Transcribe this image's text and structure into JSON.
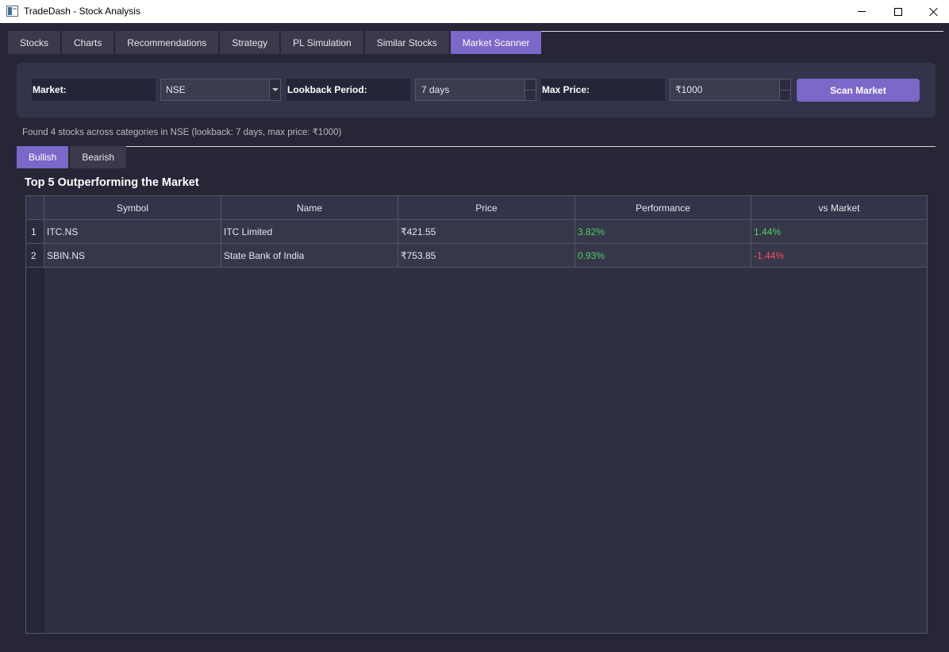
{
  "window": {
    "title": "TradeDash - Stock Analysis",
    "icon": "app-window-icon"
  },
  "main_tabs": [
    {
      "label": "Stocks",
      "active": false
    },
    {
      "label": "Charts",
      "active": false
    },
    {
      "label": "Recommendations",
      "active": false
    },
    {
      "label": "Strategy",
      "active": false
    },
    {
      "label": "PL Simulation",
      "active": false
    },
    {
      "label": "Similar Stocks",
      "active": false
    },
    {
      "label": "Market Scanner",
      "active": true
    }
  ],
  "scanner": {
    "market_label": "Market:",
    "market_value": "NSE",
    "lookback_label": "Lookback Period:",
    "lookback_value": "7 days",
    "max_price_label": "Max Price:",
    "max_price_value": "₹1000",
    "scan_button": "Scan Market"
  },
  "status": "Found 4 stocks across categories in NSE (lookback: 7 days, max price: ₹1000)",
  "sub_tabs": [
    {
      "label": "Bullish",
      "active": true
    },
    {
      "label": "Bearish",
      "active": false
    }
  ],
  "section_title": "Top 5 Outperforming the Market",
  "table": {
    "headers": [
      "Symbol",
      "Name",
      "Price",
      "Performance",
      "vs Market"
    ],
    "rows": [
      {
        "num": "1",
        "symbol": "ITC.NS",
        "name": "ITC Limited",
        "price": "₹421.55",
        "performance": "3.82%",
        "vs_market": "1.44%"
      },
      {
        "num": "2",
        "symbol": "SBIN.NS",
        "name": "State Bank of India",
        "price": "₹753.85",
        "performance": "0.93%",
        "vs_market": "-1.44%"
      }
    ]
  },
  "colors": {
    "accent": "#7b68c8",
    "positive": "#4ccf5a",
    "negative": "#ff5060",
    "background": "#262637"
  }
}
